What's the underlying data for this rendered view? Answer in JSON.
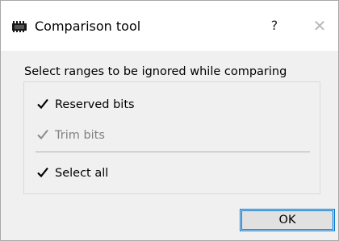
{
  "window": {
    "title": "Comparison tool",
    "help_label": "?",
    "close_label": "✕",
    "app_icon": "chip-icon"
  },
  "group": {
    "title": "Select ranges to be ignored while comparing",
    "options": [
      {
        "label": "Reserved bits",
        "checked": true,
        "enabled": true
      },
      {
        "label": "Trim bits",
        "checked": true,
        "enabled": false
      },
      {
        "label": "Select all",
        "checked": true,
        "enabled": true
      }
    ]
  },
  "buttons": {
    "ok_label": "OK"
  },
  "colors": {
    "accent": "#0078d7",
    "disabled_text": "#808080"
  }
}
